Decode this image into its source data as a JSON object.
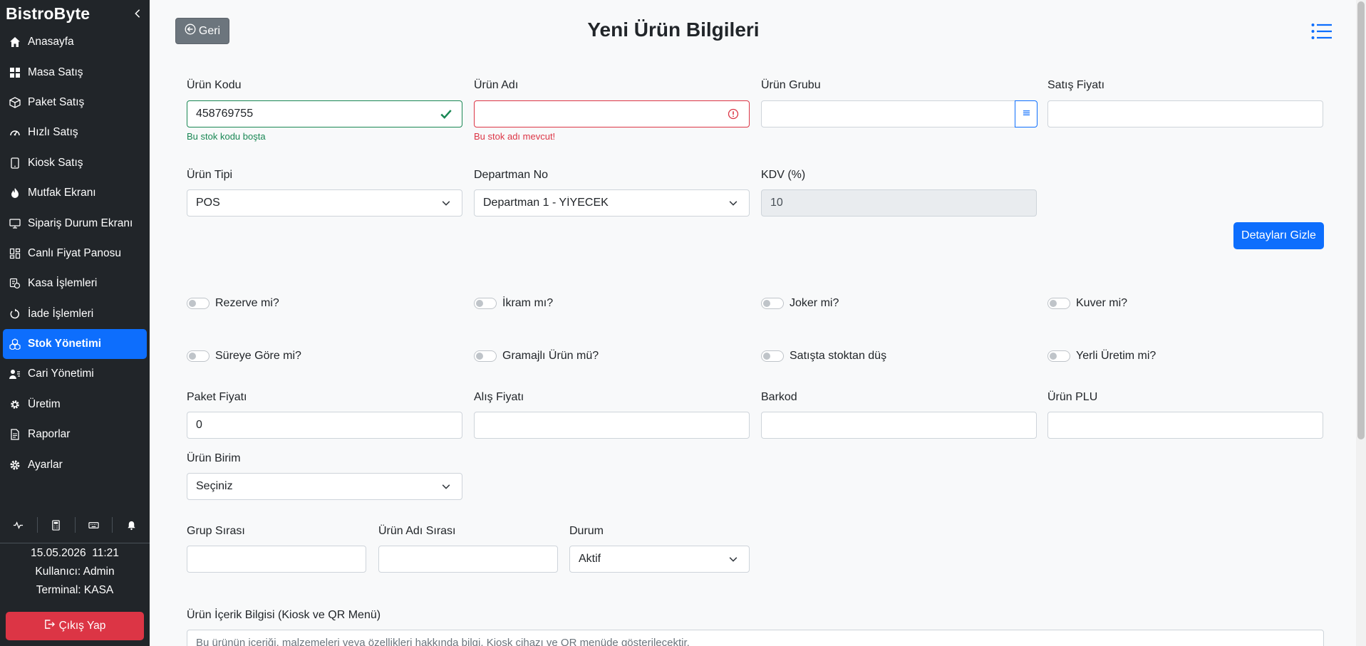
{
  "sidebar": {
    "brand": "BistroByte",
    "items": [
      {
        "label": "Anasayfa"
      },
      {
        "label": "Masa Satış"
      },
      {
        "label": "Paket Satış"
      },
      {
        "label": "Hızlı Satış"
      },
      {
        "label": "Kiosk Satış"
      },
      {
        "label": "Mutfak Ekranı"
      },
      {
        "label": "Sipariş Durum Ekranı"
      },
      {
        "label": "Canlı Fiyat Panosu"
      },
      {
        "label": "Kasa İşlemleri"
      },
      {
        "label": "İade İşlemleri"
      },
      {
        "label": "Stok Yönetimi"
      },
      {
        "label": "Cari Yönetimi"
      },
      {
        "label": "Üretim"
      },
      {
        "label": "Raporlar"
      },
      {
        "label": "Ayarlar"
      }
    ],
    "active_index": 10,
    "datetime": "15.05.2026  11:21",
    "user": "Kullanıcı: Admin",
    "terminal": "Terminal: KASA",
    "logout_label": "Çıkış Yap"
  },
  "header": {
    "back_label": "Geri",
    "title": "Yeni Ürün Bilgileri"
  },
  "form": {
    "urun_kodu": {
      "label": "Ürün Kodu",
      "value": "458769755",
      "feedback": "Bu stok kodu boşta"
    },
    "urun_adi": {
      "label": "Ürün Adı",
      "value": "",
      "feedback": "Bu stok adı mevcut!"
    },
    "urun_grubu": {
      "label": "Ürün Grubu",
      "value": ""
    },
    "satis_fiyati": {
      "label": "Satış Fiyatı",
      "value": ""
    },
    "urun_tipi": {
      "label": "Ürün Tipi",
      "value": "POS"
    },
    "departman_no": {
      "label": "Departman No",
      "value": "Departman 1 - YİYECEK"
    },
    "kdv": {
      "label": "KDV (%)",
      "value": "10"
    },
    "details_button": "Detayları Gizle",
    "switches": {
      "rezerve": "Rezerve mi?",
      "ikram": "İkram mı?",
      "joker": "Joker mi?",
      "kuver": "Kuver mi?",
      "sureye_gore": "Süreye Göre mi?",
      "gramajli": "Gramajlı Ürün mü?",
      "satista_stoktan_dus": "Satışta stoktan düş",
      "yerli_uretim": "Yerli Üretim mi?"
    },
    "paket_fiyati": {
      "label": "Paket Fiyatı",
      "value": "0"
    },
    "alis_fiyati": {
      "label": "Alış Fiyatı",
      "value": ""
    },
    "barkod": {
      "label": "Barkod",
      "value": ""
    },
    "urun_plu": {
      "label": "Ürün PLU",
      "value": ""
    },
    "urun_birim": {
      "label": "Ürün Birim",
      "value": "Seçiniz"
    },
    "grup_sirasi": {
      "label": "Grup Sırası",
      "value": ""
    },
    "urun_adi_sirasi": {
      "label": "Ürün Adı Sırası",
      "value": ""
    },
    "durum": {
      "label": "Durum",
      "value": "Aktif"
    },
    "icerik": {
      "label": "Ürün İçerik Bilgisi (Kiosk ve QR Menü)",
      "placeholder": "Bu ürünün içeriği, malzemeleri veya özellikleri hakkında bilgi. Kiosk cihazı ve QR menüde gösterilecektir."
    }
  },
  "colors": {
    "primary": "#0d6efd",
    "danger": "#dc3545",
    "success": "#198754",
    "sidebar": "#212529",
    "secondary": "#6c757d"
  }
}
